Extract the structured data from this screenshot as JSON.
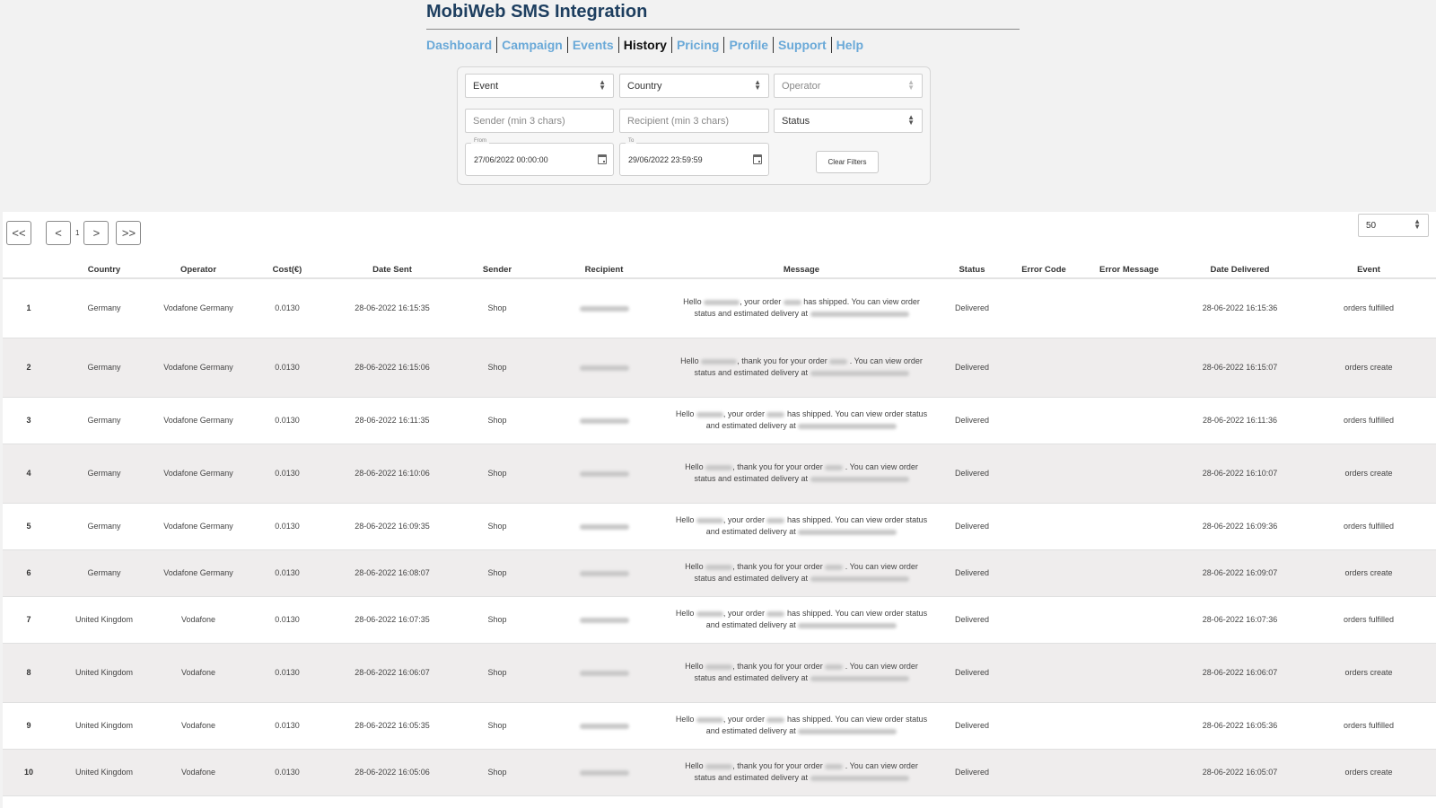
{
  "app": {
    "title": "MobiWeb SMS Integration"
  },
  "nav": {
    "items": [
      {
        "label": "Dashboard",
        "active": false
      },
      {
        "label": "Campaign",
        "active": false
      },
      {
        "label": "Events",
        "active": false
      },
      {
        "label": "History",
        "active": true
      },
      {
        "label": "Pricing",
        "active": false
      },
      {
        "label": "Profile",
        "active": false
      },
      {
        "label": "Support",
        "active": false
      },
      {
        "label": "Help",
        "active": false
      }
    ]
  },
  "filters": {
    "event_select": "Event",
    "country_select": "Country",
    "operator_select": "Operator",
    "sender_placeholder": "Sender (min 3 chars)",
    "recipient_placeholder": "Recipient (min 3 chars)",
    "status_select": "Status",
    "from_label": "From",
    "from_value": "27/06/2022 00:00:00",
    "to_label": "To",
    "to_value": "29/06/2022 23:59:59",
    "clear_button": "Clear Filters"
  },
  "pagination": {
    "first": "<<",
    "prev": "<",
    "current_page": "1",
    "next": ">",
    "last": ">>",
    "per_page": "50"
  },
  "table": {
    "columns": [
      "",
      "Country",
      "Operator",
      "Cost(€)",
      "Date Sent",
      "Sender",
      "Recipient",
      "Message",
      "Status",
      "Error Code",
      "Error Message",
      "Date Delivered",
      "Event"
    ],
    "rows": [
      {
        "idx": "1",
        "country": "Germany",
        "operator": "Vodafone Germany",
        "cost": "0.0130",
        "date_sent": "28-06-2022 16:15:35",
        "sender": "Shop",
        "recipient": "[redacted]",
        "message_type": "shipped",
        "status": "Delivered",
        "error_code": "",
        "error_message": "",
        "date_delivered": "28-06-2022 16:15:36",
        "event": "orders fulfilled"
      },
      {
        "idx": "2",
        "country": "Germany",
        "operator": "Vodafone Germany",
        "cost": "0.0130",
        "date_sent": "28-06-2022 16:15:06",
        "sender": "Shop",
        "recipient": "[redacted]",
        "message_type": "thanks",
        "status": "Delivered",
        "error_code": "",
        "error_message": "",
        "date_delivered": "28-06-2022 16:15:07",
        "event": "orders create"
      },
      {
        "idx": "3",
        "country": "Germany",
        "operator": "Vodafone Germany",
        "cost": "0.0130",
        "date_sent": "28-06-2022 16:11:35",
        "sender": "Shop",
        "recipient": "[redacted]",
        "message_type": "shipped",
        "status": "Delivered",
        "error_code": "",
        "error_message": "",
        "date_delivered": "28-06-2022 16:11:36",
        "event": "orders fulfilled"
      },
      {
        "idx": "4",
        "country": "Germany",
        "operator": "Vodafone Germany",
        "cost": "0.0130",
        "date_sent": "28-06-2022 16:10:06",
        "sender": "Shop",
        "recipient": "[redacted]",
        "message_type": "thanks",
        "status": "Delivered",
        "error_code": "",
        "error_message": "",
        "date_delivered": "28-06-2022 16:10:07",
        "event": "orders create"
      },
      {
        "idx": "5",
        "country": "Germany",
        "operator": "Vodafone Germany",
        "cost": "0.0130",
        "date_sent": "28-06-2022 16:09:35",
        "sender": "Shop",
        "recipient": "[redacted]",
        "message_type": "shipped",
        "status": "Delivered",
        "error_code": "",
        "error_message": "",
        "date_delivered": "28-06-2022 16:09:36",
        "event": "orders fulfilled"
      },
      {
        "idx": "6",
        "country": "Germany",
        "operator": "Vodafone Germany",
        "cost": "0.0130",
        "date_sent": "28-06-2022 16:08:07",
        "sender": "Shop",
        "recipient": "[redacted]",
        "message_type": "thanks",
        "status": "Delivered",
        "error_code": "",
        "error_message": "",
        "date_delivered": "28-06-2022 16:09:07",
        "event": "orders create"
      },
      {
        "idx": "7",
        "country": "United Kingdom",
        "operator": "Vodafone",
        "cost": "0.0130",
        "date_sent": "28-06-2022 16:07:35",
        "sender": "Shop",
        "recipient": "[redacted]",
        "message_type": "shipped",
        "status": "Delivered",
        "error_code": "",
        "error_message": "",
        "date_delivered": "28-06-2022 16:07:36",
        "event": "orders fulfilled"
      },
      {
        "idx": "8",
        "country": "United Kingdom",
        "operator": "Vodafone",
        "cost": "0.0130",
        "date_sent": "28-06-2022 16:06:07",
        "sender": "Shop",
        "recipient": "[redacted]",
        "message_type": "thanks",
        "status": "Delivered",
        "error_code": "",
        "error_message": "",
        "date_delivered": "28-06-2022 16:06:07",
        "event": "orders create"
      },
      {
        "idx": "9",
        "country": "United Kingdom",
        "operator": "Vodafone",
        "cost": "0.0130",
        "date_sent": "28-06-2022 16:05:35",
        "sender": "Shop",
        "recipient": "[redacted]",
        "message_type": "shipped",
        "status": "Delivered",
        "error_code": "",
        "error_message": "",
        "date_delivered": "28-06-2022 16:05:36",
        "event": "orders fulfilled"
      },
      {
        "idx": "10",
        "country": "United Kingdom",
        "operator": "Vodafone",
        "cost": "0.0130",
        "date_sent": "28-06-2022 16:05:06",
        "sender": "Shop",
        "recipient": "[redacted]",
        "message_type": "thanks",
        "status": "Delivered",
        "error_code": "",
        "error_message": "",
        "date_delivered": "28-06-2022 16:05:07",
        "event": "orders create"
      }
    ],
    "message_templates": {
      "shipped": {
        "p1": "Hello",
        "p2": ", your order",
        "p3": "has shipped. You can view order status and estimated delivery at"
      },
      "thanks": {
        "p1": "Hello",
        "p2": ", thank you for your order",
        "p3": ". You can view order status and estimated delivery at"
      }
    }
  }
}
